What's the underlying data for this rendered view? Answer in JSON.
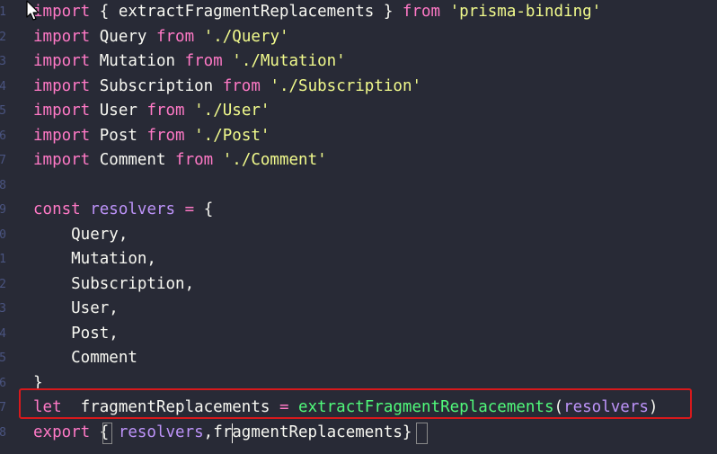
{
  "editor": {
    "line_numbers": [
      "1",
      "2",
      "3",
      "4",
      "5",
      "6",
      "7",
      "8",
      "9",
      "0",
      "1",
      "2",
      "3",
      "4",
      "5",
      "6",
      "7",
      "8"
    ],
    "lines": [
      [
        {
          "t": "import",
          "c": "kw"
        },
        {
          "t": " { extractFragmentReplacements } ",
          "c": "id"
        },
        {
          "t": "from",
          "c": "kw"
        },
        {
          "t": " ",
          "c": "id"
        },
        {
          "t": "'prisma-binding'",
          "c": "str"
        }
      ],
      [
        {
          "t": "import",
          "c": "kw"
        },
        {
          "t": " Query ",
          "c": "id"
        },
        {
          "t": "from",
          "c": "kw"
        },
        {
          "t": " ",
          "c": "id"
        },
        {
          "t": "'./Query'",
          "c": "str"
        }
      ],
      [
        {
          "t": "import",
          "c": "kw"
        },
        {
          "t": " Mutation ",
          "c": "id"
        },
        {
          "t": "from",
          "c": "kw"
        },
        {
          "t": " ",
          "c": "id"
        },
        {
          "t": "'./Mutation'",
          "c": "str"
        }
      ],
      [
        {
          "t": "import",
          "c": "kw"
        },
        {
          "t": " Subscription ",
          "c": "id"
        },
        {
          "t": "from",
          "c": "kw"
        },
        {
          "t": " ",
          "c": "id"
        },
        {
          "t": "'./Subscription'",
          "c": "str"
        }
      ],
      [
        {
          "t": "import",
          "c": "kw"
        },
        {
          "t": " User ",
          "c": "id"
        },
        {
          "t": "from",
          "c": "kw"
        },
        {
          "t": " ",
          "c": "id"
        },
        {
          "t": "'./User'",
          "c": "str"
        }
      ],
      [
        {
          "t": "import",
          "c": "kw"
        },
        {
          "t": " Post ",
          "c": "id"
        },
        {
          "t": "from",
          "c": "kw"
        },
        {
          "t": " ",
          "c": "id"
        },
        {
          "t": "'./Post'",
          "c": "str"
        }
      ],
      [
        {
          "t": "import",
          "c": "kw"
        },
        {
          "t": " Comment ",
          "c": "id"
        },
        {
          "t": "from",
          "c": "kw"
        },
        {
          "t": " ",
          "c": "id"
        },
        {
          "t": "'./Comment'",
          "c": "str"
        }
      ],
      [],
      [
        {
          "t": "const",
          "c": "kw"
        },
        {
          "t": " ",
          "c": "id"
        },
        {
          "t": "resolvers",
          "c": "var"
        },
        {
          "t": " ",
          "c": "id"
        },
        {
          "t": "=",
          "c": "kw"
        },
        {
          "t": " {",
          "c": "punc"
        }
      ],
      [
        {
          "t": "    Query,",
          "c": "id"
        }
      ],
      [
        {
          "t": "    Mutation,",
          "c": "id"
        }
      ],
      [
        {
          "t": "    Subscription,",
          "c": "id"
        }
      ],
      [
        {
          "t": "    User,",
          "c": "id"
        }
      ],
      [
        {
          "t": "    Post,",
          "c": "id"
        }
      ],
      [
        {
          "t": "    Comment",
          "c": "id"
        }
      ],
      [
        {
          "t": "}",
          "c": "punc"
        }
      ],
      [
        {
          "t": "let",
          "c": "kw"
        },
        {
          "t": "  fragmentReplacements ",
          "c": "id"
        },
        {
          "t": "=",
          "c": "kw"
        },
        {
          "t": " ",
          "c": "id"
        },
        {
          "t": "extractFragmentReplacements",
          "c": "fn"
        },
        {
          "t": "(",
          "c": "punc"
        },
        {
          "t": "resolvers",
          "c": "var"
        },
        {
          "t": ")",
          "c": "punc"
        }
      ],
      [
        {
          "t": "export",
          "c": "kw"
        },
        {
          "t": " { ",
          "c": "punc"
        },
        {
          "t": "resolvers",
          "c": "var"
        },
        {
          "t": ",fragmentReplacements}",
          "c": "id"
        }
      ]
    ]
  },
  "colors": {
    "background": "#282a36",
    "keyword": "#ff79c6",
    "string": "#f1fa8c",
    "variable": "#bd93f9",
    "function": "#50fa7b",
    "text": "#f8f8f2",
    "highlight_border": "#d7191c"
  },
  "icons": {
    "mouse_pointer": "arrow-cursor-icon"
  }
}
